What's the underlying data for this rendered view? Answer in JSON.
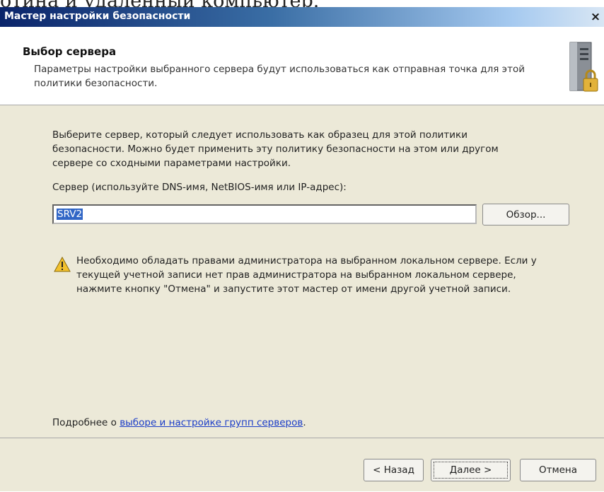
{
  "document_fragment": "отина и удаленный компьютер.",
  "window": {
    "title": "Мастер настройки безопасности",
    "close_label": "×"
  },
  "header": {
    "title": "Выбор сервера",
    "description": "Параметры настройки выбранного сервера будут использоваться как отправная точка для этой политики безопасности.",
    "icon": "server-lock-icon"
  },
  "main": {
    "intro": "Выберите сервер, который следует использовать как образец для этой политики безопасности. Можно будет применить эту политику безопасности на этом или другом сервере со сходными параметрами настройки.",
    "server_label": "Сервер (используйте DNS-имя, NetBIOS-имя или IP-адрес):",
    "server_value": "SRV2",
    "browse_label": "Обзор...",
    "warning_icon": "warning-icon",
    "warning_text": "Необходимо обладать правами администратора на выбранном локальном сервере. Если у текущей учетной записи нет прав администратора на выбранном локальном сервере, нажмите кнопку \"Отмена\" и запустите этот мастер от имени другой учетной записи.",
    "more_info_prefix": "Подробнее о ",
    "more_info_link": "выборе и настройке групп серверов",
    "more_info_suffix": "."
  },
  "footer": {
    "back_label": "< Назад",
    "next_label": "Далее >",
    "cancel_label": "Отмена"
  },
  "colors": {
    "titlebar_start": "#0a246a",
    "titlebar_end": "#d8e6f4",
    "dialog_background": "#ece9d8",
    "selection": "#3166c6",
    "link": "#1a3cc8"
  }
}
